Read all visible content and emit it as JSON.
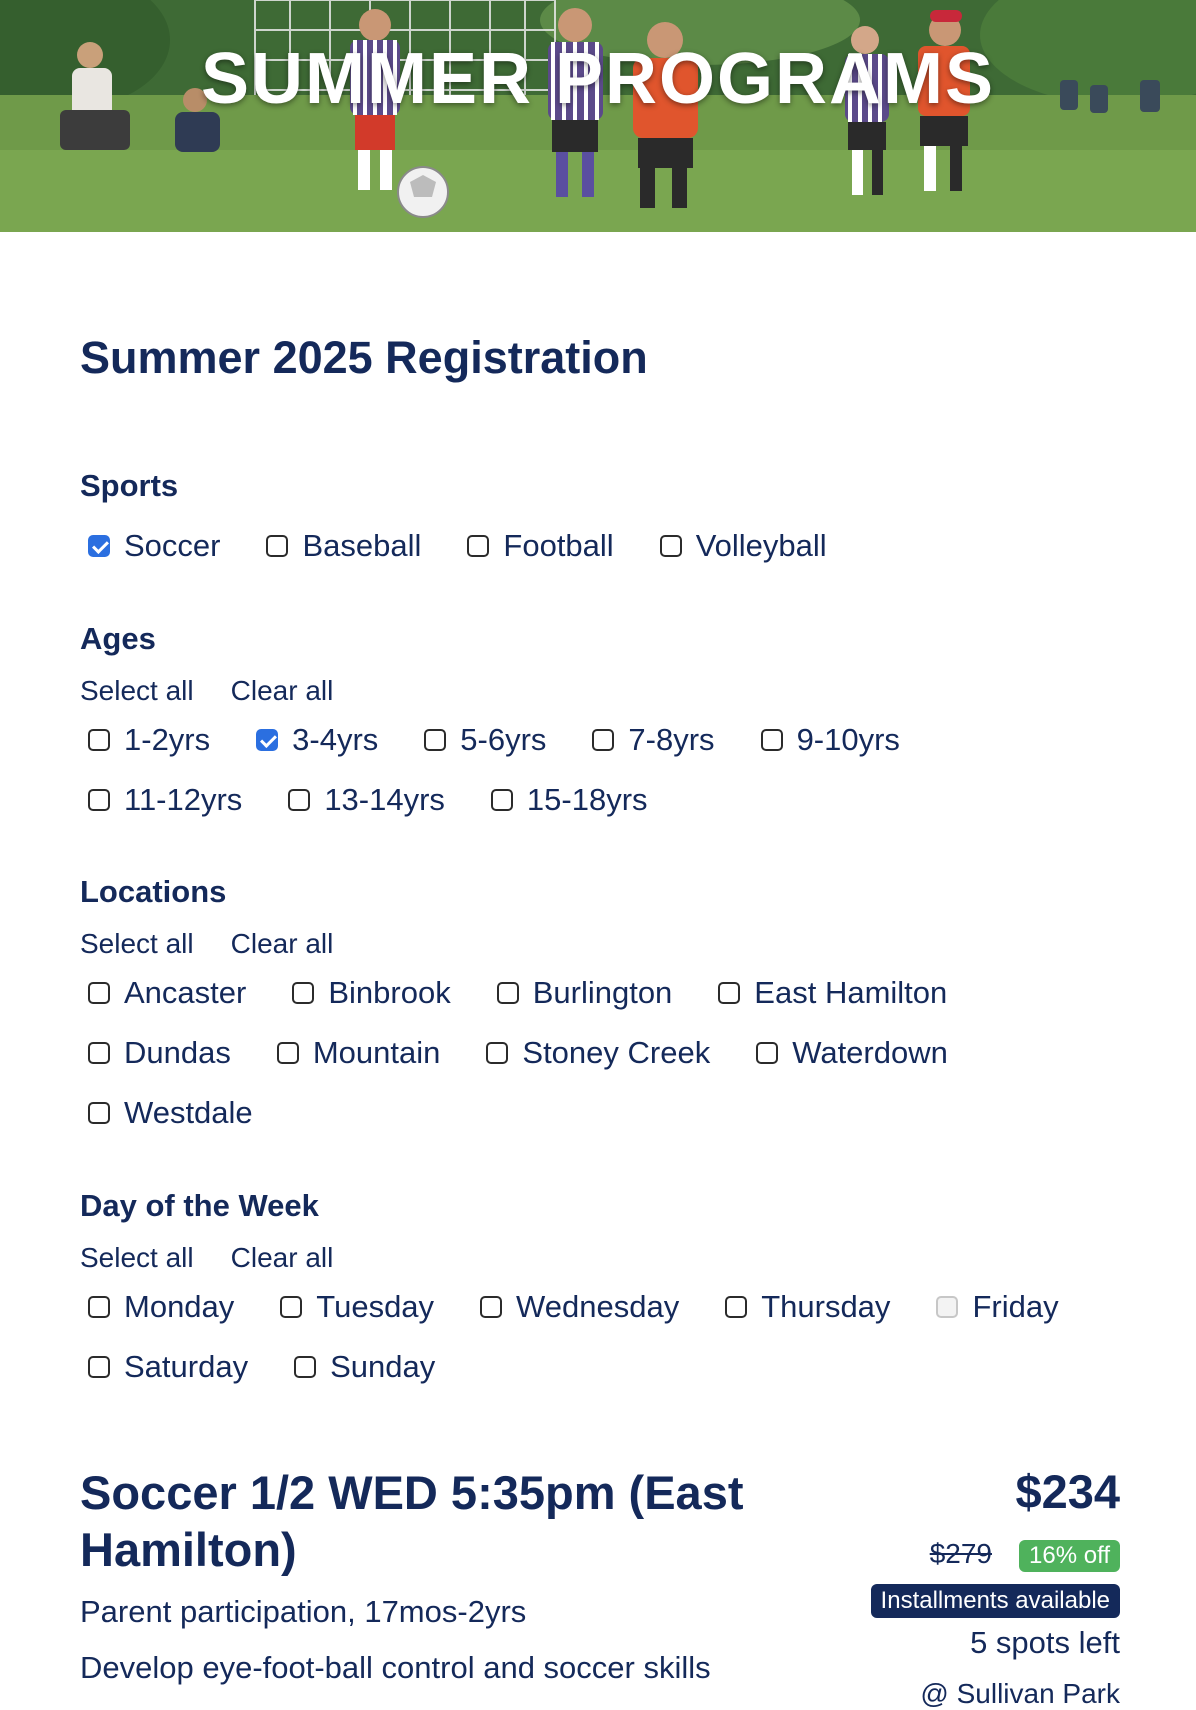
{
  "hero": {
    "title": "SUMMER PROGRAMS",
    "image": "youth-soccer-game-photo"
  },
  "page_title": "Summer 2025 Registration",
  "sections": {
    "sports": {
      "title": "Sports",
      "options": [
        {
          "label": "Soccer",
          "checked": true
        },
        {
          "label": "Baseball",
          "checked": false
        },
        {
          "label": "Football",
          "checked": false
        },
        {
          "label": "Volleyball",
          "checked": false
        }
      ]
    },
    "ages": {
      "title": "Ages",
      "select_all": "Select all",
      "clear_all": "Clear all",
      "options": [
        {
          "label": "1-2yrs",
          "checked": false
        },
        {
          "label": "3-4yrs",
          "checked": true
        },
        {
          "label": "5-6yrs",
          "checked": false
        },
        {
          "label": "7-8yrs",
          "checked": false
        },
        {
          "label": "9-10yrs",
          "checked": false
        },
        {
          "label": "11-12yrs",
          "checked": false
        },
        {
          "label": "13-14yrs",
          "checked": false
        },
        {
          "label": "15-18yrs",
          "checked": false
        }
      ]
    },
    "locations": {
      "title": "Locations",
      "select_all": "Select all",
      "clear_all": "Clear all",
      "options": [
        {
          "label": "Ancaster",
          "checked": false
        },
        {
          "label": "Binbrook",
          "checked": false
        },
        {
          "label": "Burlington",
          "checked": false
        },
        {
          "label": "East Hamilton",
          "checked": false
        },
        {
          "label": "Dundas",
          "checked": false
        },
        {
          "label": "Mountain",
          "checked": false
        },
        {
          "label": "Stoney Creek",
          "checked": false
        },
        {
          "label": "Waterdown",
          "checked": false
        },
        {
          "label": "Westdale",
          "checked": false
        }
      ]
    },
    "days": {
      "title": "Day of the Week",
      "select_all": "Select all",
      "clear_all": "Clear all",
      "options": [
        {
          "label": "Monday",
          "checked": false
        },
        {
          "label": "Tuesday",
          "checked": false
        },
        {
          "label": "Wednesday",
          "checked": false
        },
        {
          "label": "Thursday",
          "checked": false
        },
        {
          "label": "Friday",
          "checked": false,
          "disabled": true
        },
        {
          "label": "Saturday",
          "checked": false
        },
        {
          "label": "Sunday",
          "checked": false
        }
      ]
    }
  },
  "program": {
    "title": "Soccer 1/2 WED 5:35pm (East Hamilton)",
    "subtitle": "Parent participation, 17mos-2yrs",
    "description": "Develop eye-foot-ball control and soccer skills",
    "price": "$234",
    "original_price": "$279",
    "discount": "16% off",
    "installments": "Installments available",
    "spots": "5 spots left",
    "venue": "@ Sullivan Park"
  },
  "colors": {
    "navy": "#14295a",
    "checkbox_checked": "#2b6fe0",
    "discount_green": "#4fb25c"
  }
}
